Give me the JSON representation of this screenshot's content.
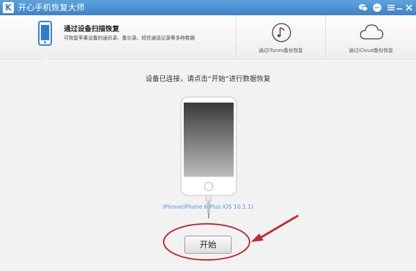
{
  "titlebar": {
    "logo_letter": "K",
    "title": "开心手机恢复大师",
    "icons": [
      "wechat-icon",
      "chat-icon",
      "menu-icon",
      "minimize-icon",
      "close-icon"
    ]
  },
  "tabs": [
    {
      "id": "scan",
      "title": "通过设备扫描恢复",
      "desc": "可恢复苹果设备的通讯录、备忘录、短信通话记录等多种数据",
      "icon": "phone-icon",
      "active": true
    },
    {
      "id": "itunes",
      "label": "通过iTunes备份恢复",
      "icon": "music-note-icon"
    },
    {
      "id": "icloud",
      "label": "通过iCloud备份恢复",
      "icon": "cloud-icon"
    }
  ],
  "main": {
    "status": "设备已连接，请点击“开始”进行数据恢复",
    "device_name": "iPhone(iPhone 6 Plus iOS 10.1.1)",
    "start_button": "开始"
  },
  "colors": {
    "titlebar": "#3c82c6",
    "accent_blue": "#2f7fd1",
    "annotation_red": "#c0282c",
    "device_label": "#5a8fd3"
  }
}
